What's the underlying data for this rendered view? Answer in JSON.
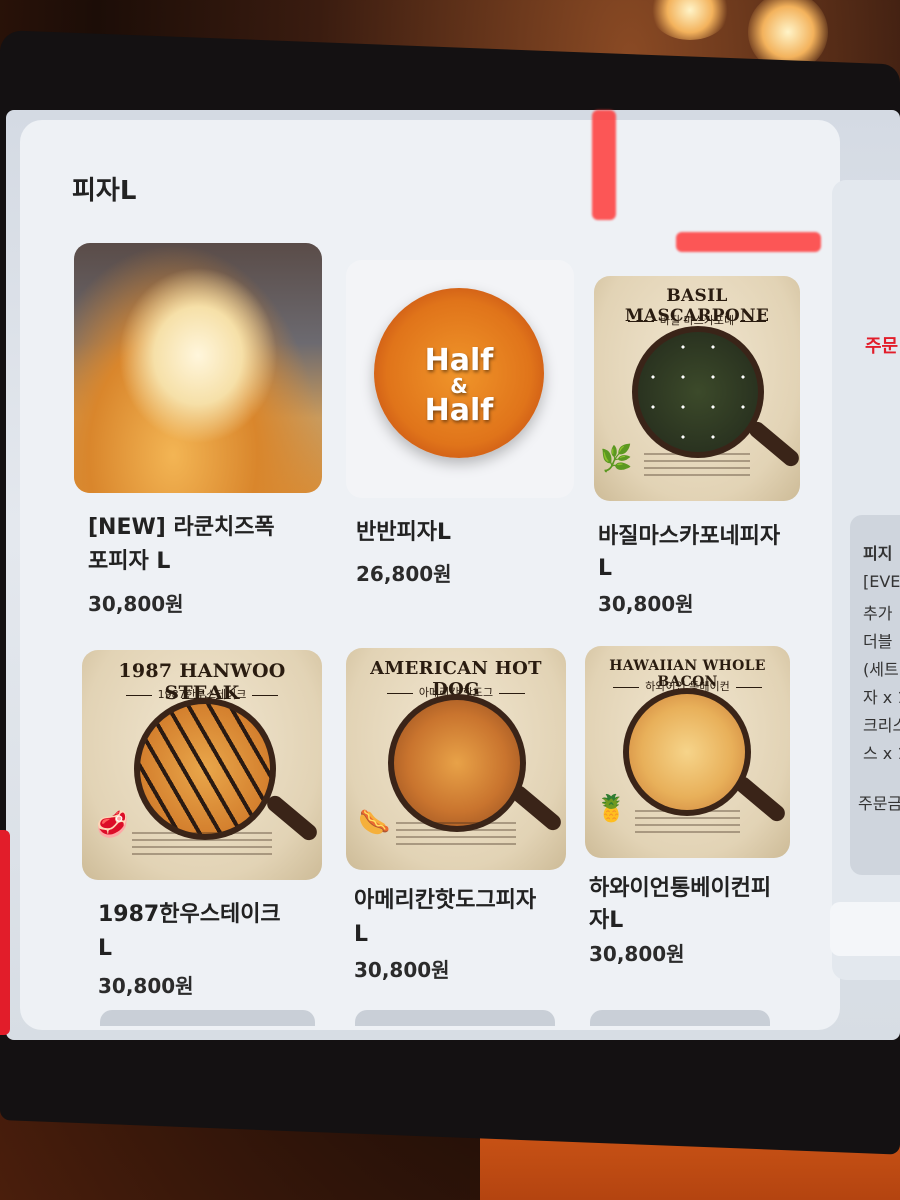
{
  "section_title": "피자L",
  "menu": [
    {
      "name_line1": "[NEW] 라쿤치즈폭",
      "name_line2": "포피자 L",
      "price": "30,800원"
    },
    {
      "name_line1": "반반피자L",
      "name_line2": "",
      "price": "26,800원",
      "image_text": [
        "Half",
        "&",
        "Half"
      ]
    },
    {
      "name_line1": "바질마스카포네피자",
      "name_line2": "L",
      "price": "30,800원",
      "poster_title": "BASIL MASCARPONE",
      "poster_subtitle": "바질 마스카포네"
    },
    {
      "name_line1": "1987한우스테이크",
      "name_line2": "L",
      "price": "30,800원",
      "poster_title": "1987 HANWOO STEAK",
      "poster_subtitle": "1987한우스테이크"
    },
    {
      "name_line1": "아메리칸핫도그피자",
      "name_line2": "L",
      "price": "30,800원",
      "poster_title": "AMERICAN HOT DOG",
      "poster_subtitle": "아메리칸 핫도그"
    },
    {
      "name_line1": "하와이언통베이컨피",
      "name_line2": "자L",
      "price": "30,800원",
      "poster_title": "HAWAIIAN WHOLE BACON",
      "poster_subtitle": "하와이언 통베이컨"
    }
  ],
  "side_panel": {
    "order_label": "주문",
    "item_title": "피지",
    "lines": [
      "[EVE",
      "추가",
      "더블",
      "(세트",
      "자 x 1",
      "크리스",
      "스 x 1"
    ],
    "total_label": "주문금"
  },
  "colors": {
    "accent": "#e21d2a",
    "panel": "#eef1f5"
  }
}
